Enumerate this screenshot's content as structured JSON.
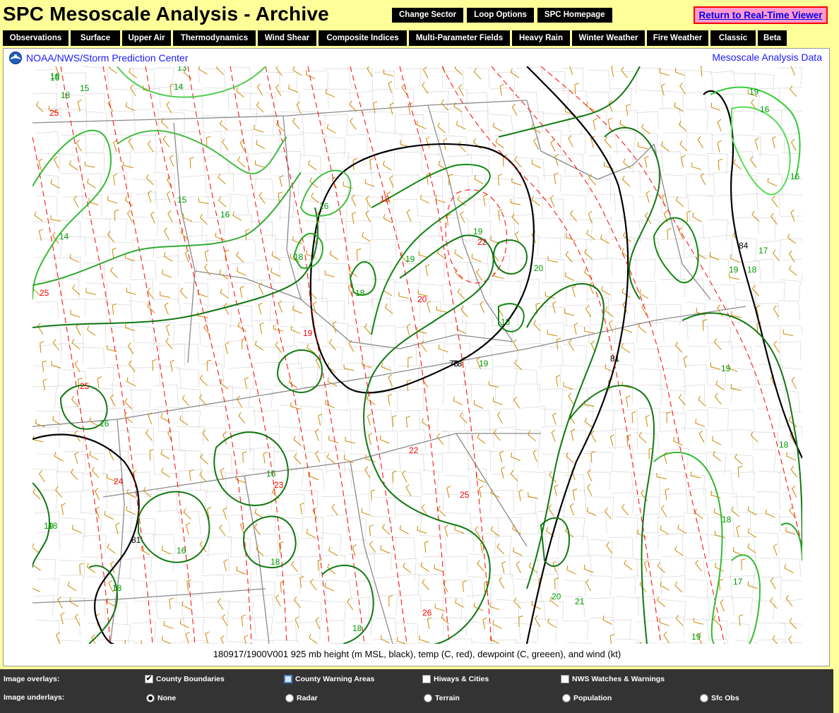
{
  "header": {
    "title": "SPC Mesoscale Analysis - Archive",
    "buttons": [
      "Change Sector",
      "Loop Options",
      "SPC Homepage"
    ],
    "realtime_link": "Return to Real-Time Viewer"
  },
  "nav": {
    "tabs": [
      "Observations",
      "Surface",
      "Upper Air",
      "Thermodynamics",
      "Wind Shear",
      "Composite Indices",
      "Multi-Parameter Fields",
      "Heavy Rain",
      "Winter Weather",
      "Fire Weather",
      "Classic",
      "Beta"
    ]
  },
  "map": {
    "org_label": "NOAA/NWS/Storm Prediction Center",
    "right_label": "Mesoscale Analysis Data",
    "caption": "180917/1900V001 925 mb height (m MSL, black), temp (C, red), dewpoint (C, greeen), and wind (kt)",
    "colors": {
      "height": "#000000",
      "temp": "#ff0000",
      "dewpoint": "#009900",
      "wind": "#cc8800",
      "borders": "#999999"
    },
    "labels": {
      "height": [
        "78",
        "78",
        "81",
        "84",
        "81"
      ],
      "temp": [
        "25",
        "25",
        "25",
        "18",
        "22",
        "20",
        "19",
        "22",
        "23",
        "24",
        "25",
        "26"
      ],
      "dewpoint": [
        "13",
        "14",
        "16",
        "18",
        "15",
        "16",
        "14",
        "16",
        "18",
        "18",
        "19",
        "19",
        "18",
        "19",
        "20",
        "19",
        "16",
        "16",
        "18",
        "19",
        "18",
        "16",
        "16",
        "18",
        "19",
        "18",
        "18",
        "16",
        "17",
        "18",
        "20",
        "21",
        "17",
        "19",
        "18",
        "16",
        "15",
        "19"
      ]
    }
  },
  "overlays": {
    "overlays_label": "Image overlays:",
    "underlays_label": "Image underlays:",
    "overlay_items": [
      {
        "label": "County Boundaries",
        "checked": true
      },
      {
        "label": "County Warning Areas",
        "checked": false
      },
      {
        "label": "Hiways & Cities",
        "checked": false
      },
      {
        "label": "NWS Watches & Warnings",
        "checked": false
      }
    ],
    "underlay_items": [
      {
        "label": "None",
        "selected": true
      },
      {
        "label": "Radar",
        "selected": false
      },
      {
        "label": "Terrain",
        "selected": false
      },
      {
        "label": "Population",
        "selected": false
      },
      {
        "label": "Sfc Obs",
        "selected": false
      }
    ]
  }
}
